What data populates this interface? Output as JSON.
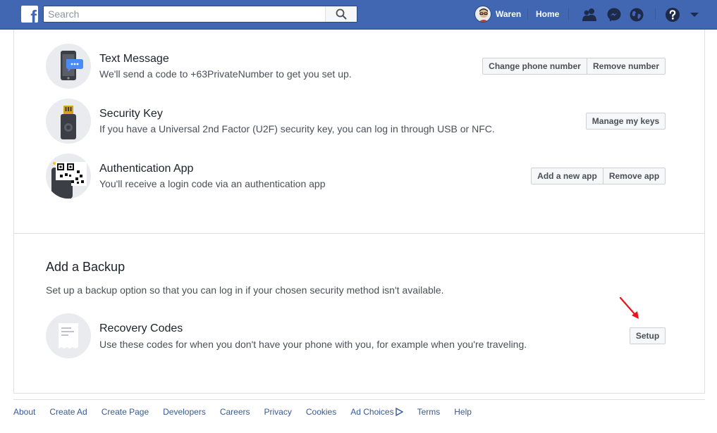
{
  "topbar": {
    "logo_letter": "f",
    "search_placeholder": "Search",
    "user_name": "Waren",
    "home_label": "Home",
    "icons": [
      "friends-icon",
      "messenger-icon",
      "notifications-globe-icon",
      "help-icon",
      "menu-chevron-icon"
    ],
    "brand_color": "#4267b2"
  },
  "methods": [
    {
      "title": "Text Message",
      "description": "We'll send a code to +63PrivateNumber to get you set up.",
      "icon": "phone-icon",
      "buttons": [
        "Change phone number",
        "Remove number"
      ]
    },
    {
      "title": "Security Key",
      "description": "If you have a Universal 2nd Factor (U2F) security key, you can log in through USB or NFC.",
      "icon": "usb-key-icon",
      "buttons": [
        "Manage my keys"
      ]
    },
    {
      "title": "Authentication App",
      "description": "You'll receive a login code via an authentication app",
      "icon": "qr-code-phone-icon",
      "buttons": [
        "Add a new app",
        "Remove app"
      ]
    }
  ],
  "backup": {
    "section_title": "Add a Backup",
    "section_description": "Set up a backup option so that you can log in if your chosen security method isn't available.",
    "recovery_title": "Recovery Codes",
    "recovery_description": "Use these codes for when you don't have your phone with you, for example when you're traveling.",
    "recovery_icon": "document-icon",
    "setup_label": "Setup",
    "annotation_color": "#e8141b"
  },
  "footer": {
    "links": [
      "About",
      "Create Ad",
      "Create Page",
      "Developers",
      "Careers",
      "Privacy",
      "Cookies",
      "Ad Choices",
      "Terms",
      "Help"
    ]
  }
}
